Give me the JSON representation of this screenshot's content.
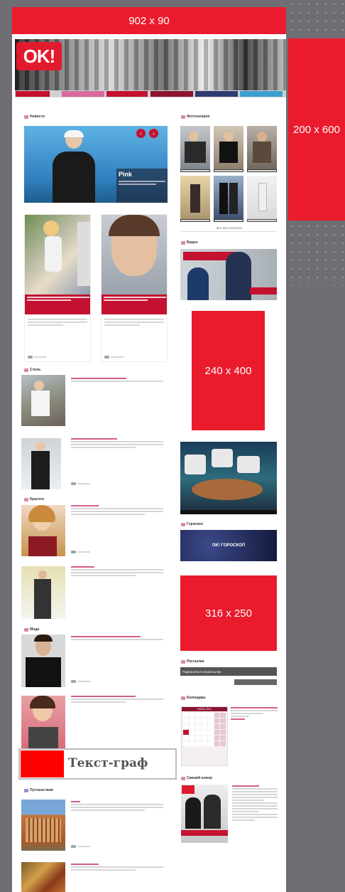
{
  "ads": {
    "top": "902 x 90",
    "side": "200 x 600",
    "mid": "240 x 400",
    "square": "316 x 250",
    "textgraph": "Текст-граф"
  },
  "logo": "OK!",
  "hero_name": "Pink",
  "sections": {
    "news": "Новости",
    "photos": "Фотогалерея",
    "style": "Стиль",
    "beauty": "Красота",
    "fashion": "Мода",
    "video": "Видео",
    "horoscope": "Гороскоп",
    "subscribe": "Рассылка",
    "calendar": "Календарь",
    "people": "Свежий номер",
    "travel": "Путешествия"
  },
  "more_photos": "Все фотогалереи",
  "horoscope_banner": "OK! ГОРОСКОП",
  "subscribe_bar": "Подписаться на рассылку",
  "calendar_month": "ИЮЛЬ 2013",
  "colors": {
    "ad_red": "#ea1b2d",
    "brand_red": "#c4112f",
    "accent_pink": "#c0245c",
    "background": "#6f6e74"
  }
}
